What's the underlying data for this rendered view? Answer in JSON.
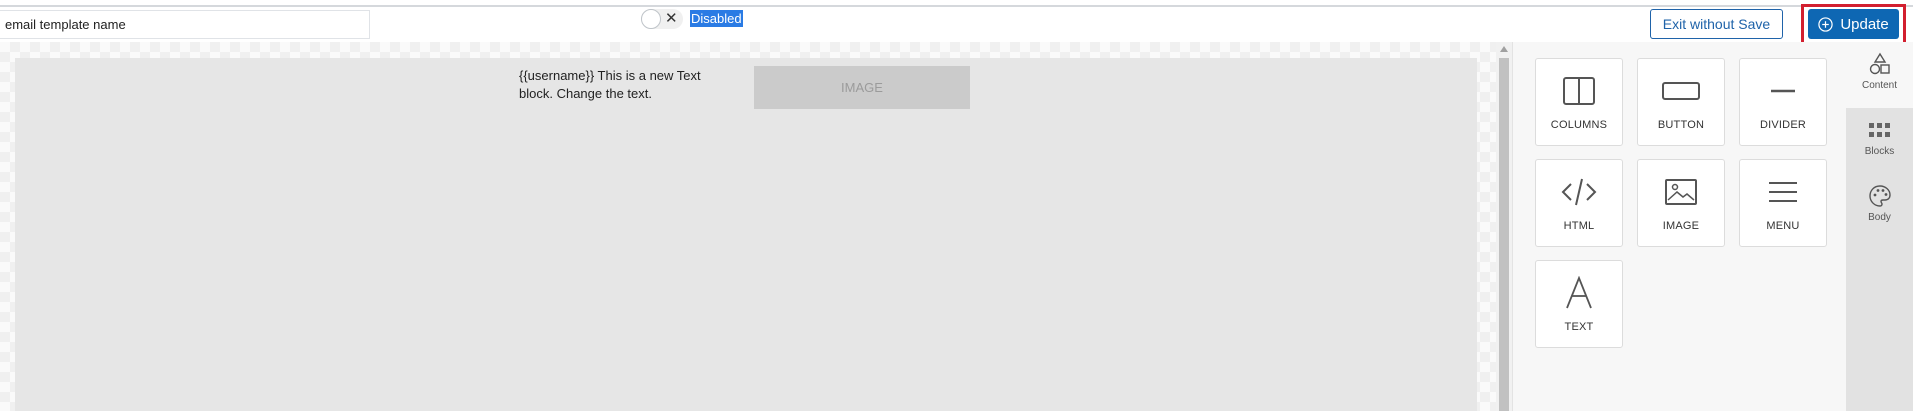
{
  "topbar": {
    "template_name_placeholder": "email template name",
    "status_toggle": {
      "state": "off",
      "label": "Disabled"
    },
    "exit_button_label": "Exit without Save",
    "update_button_label": "Update",
    "accent_color": "#0e67b3",
    "highlight_color": "#d21f2f"
  },
  "canvas": {
    "text_block": "{{username}} This is a new Text block. Change the text.",
    "image_placeholder": "IMAGE"
  },
  "content_panel": {
    "tiles": [
      {
        "label": "COLUMNS",
        "icon": "columns-icon"
      },
      {
        "label": "BUTTON",
        "icon": "button-icon"
      },
      {
        "label": "DIVIDER",
        "icon": "divider-icon"
      },
      {
        "label": "HTML",
        "icon": "html-icon"
      },
      {
        "label": "IMAGE",
        "icon": "image-icon"
      },
      {
        "label": "MENU",
        "icon": "menu-icon"
      },
      {
        "label": "TEXT",
        "icon": "text-icon"
      }
    ]
  },
  "side_tabs": [
    {
      "label": "Content",
      "icon": "shapes-icon",
      "active": true
    },
    {
      "label": "Blocks",
      "icon": "blocks-icon",
      "active": false
    },
    {
      "label": "Body",
      "icon": "palette-icon",
      "active": false
    }
  ]
}
